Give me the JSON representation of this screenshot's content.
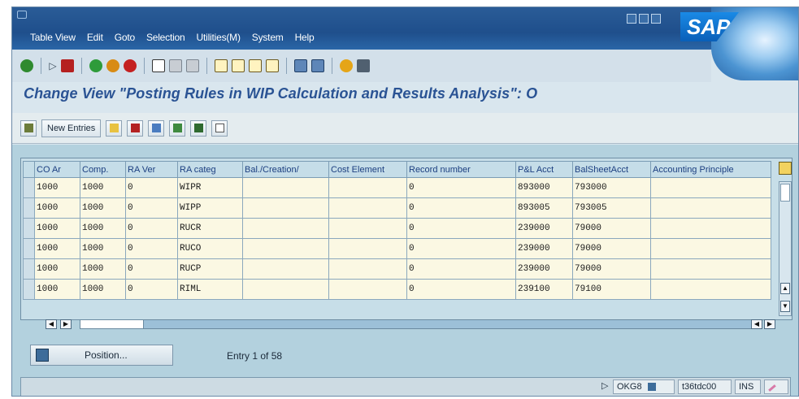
{
  "menu": [
    "Table View",
    "Edit",
    "Goto",
    "Selection",
    "Utilities(M)",
    "System",
    "Help"
  ],
  "logo": "SAP",
  "title": "Change View \"Posting Rules in WIP Calculation and Results Analysis\": O",
  "app_toolbar": {
    "new_entries_label": "New Entries"
  },
  "table": {
    "columns": [
      "CO Ar",
      "Comp.",
      "RA Ver",
      "RA categ",
      "Bal./Creation/",
      "Cost Element",
      "Record number",
      "P&L Acct",
      "BalSheetAcct",
      "Accounting Principle"
    ],
    "rows": [
      [
        "1000",
        "1000",
        "0",
        "WIPR",
        "",
        "",
        "0",
        "893000",
        "793000",
        ""
      ],
      [
        "1000",
        "1000",
        "0",
        "WIPP",
        "",
        "",
        "0",
        "893005",
        "793005",
        ""
      ],
      [
        "1000",
        "1000",
        "0",
        "RUCR",
        "",
        "",
        "0",
        "239000",
        "79000",
        ""
      ],
      [
        "1000",
        "1000",
        "0",
        "RUCO",
        "",
        "",
        "0",
        "239000",
        "79000",
        ""
      ],
      [
        "1000",
        "1000",
        "0",
        "RUCP",
        "",
        "",
        "0",
        "239000",
        "79000",
        ""
      ],
      [
        "1000",
        "1000",
        "0",
        "RIML",
        "",
        "",
        "0",
        "239100",
        "79100",
        ""
      ]
    ]
  },
  "position_button": "Position...",
  "entry_text": "Entry 1 of 58",
  "status": {
    "transaction": "OKG8",
    "server": "t36tdc00",
    "mode": "INS"
  }
}
